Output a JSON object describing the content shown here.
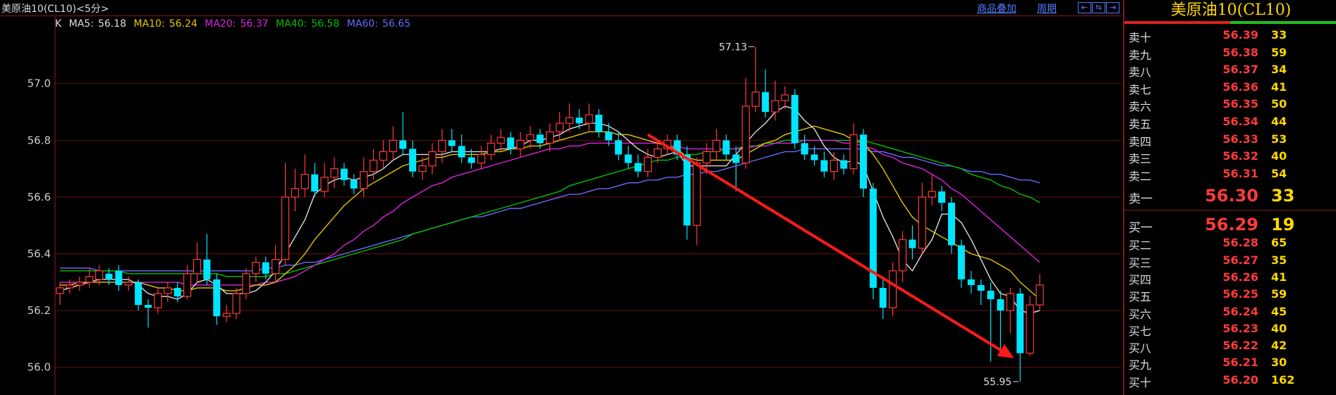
{
  "header": {
    "title": "美原油10(CL10)<5分>",
    "link_products": "商品叠加",
    "link_period": "周期",
    "nav_buttons": [
      "⇤",
      "⇆",
      "⇥"
    ]
  },
  "panel": {
    "title": "美原油10(CL10)",
    "asks": [
      {
        "label": "卖十",
        "price": "56.39",
        "vol": "33"
      },
      {
        "label": "卖九",
        "price": "56.38",
        "vol": "59"
      },
      {
        "label": "卖八",
        "price": "56.37",
        "vol": "34"
      },
      {
        "label": "卖七",
        "price": "56.36",
        "vol": "41"
      },
      {
        "label": "卖六",
        "price": "56.35",
        "vol": "50"
      },
      {
        "label": "卖五",
        "price": "56.34",
        "vol": "44"
      },
      {
        "label": "卖四",
        "price": "56.33",
        "vol": "53"
      },
      {
        "label": "卖三",
        "price": "56.32",
        "vol": "40"
      },
      {
        "label": "卖二",
        "price": "56.31",
        "vol": "54"
      },
      {
        "label": "卖一",
        "price": "56.30",
        "vol": "33"
      }
    ],
    "bids": [
      {
        "label": "买一",
        "price": "56.29",
        "vol": "19"
      },
      {
        "label": "买二",
        "price": "56.28",
        "vol": "65"
      },
      {
        "label": "买三",
        "price": "56.27",
        "vol": "35"
      },
      {
        "label": "买四",
        "price": "56.26",
        "vol": "41"
      },
      {
        "label": "买五",
        "price": "56.25",
        "vol": "59"
      },
      {
        "label": "买六",
        "price": "56.24",
        "vol": "45"
      },
      {
        "label": "买七",
        "price": "56.23",
        "vol": "40"
      },
      {
        "label": "买八",
        "price": "56.22",
        "vol": "42"
      },
      {
        "label": "买九",
        "price": "56.21",
        "vol": "30"
      },
      {
        "label": "买十",
        "price": "56.20",
        "vol": "162"
      }
    ]
  },
  "colors": {
    "up": "#ff3b3b",
    "down": "#00e5ff",
    "ma5": "#dddddd",
    "ma10": "#e6c700",
    "ma20": "#e020e0",
    "ma40": "#00c000",
    "ma60": "#6a6aff",
    "grid": "#6a0f0f",
    "arrow": "#ff1a1a"
  },
  "chart_data": {
    "type": "candlestick",
    "ylim": [
      55.91,
      57.22
    ],
    "yticks": [
      "57.0",
      "56.8",
      "56.6",
      "56.4",
      "56.2",
      "56.0"
    ],
    "legend": [
      {
        "name": "K",
        "value": ""
      },
      {
        "name": "MA5",
        "value": "56.18"
      },
      {
        "name": "MA10",
        "value": "56.24"
      },
      {
        "name": "MA20",
        "value": "56.37"
      },
      {
        "name": "MA40",
        "value": "56.58"
      },
      {
        "name": "MA60",
        "value": "56.65"
      }
    ],
    "annotations": {
      "high_label": "57.13",
      "low_label": "55.95"
    },
    "candles": [
      [
        56.26,
        56.28,
        56.22,
        56.3
      ],
      [
        56.28,
        56.29,
        56.26,
        56.31
      ],
      [
        56.29,
        56.3,
        56.27,
        56.32
      ],
      [
        56.3,
        56.32,
        56.28,
        56.35
      ],
      [
        56.31,
        56.34,
        56.29,
        56.36
      ],
      [
        56.33,
        56.31,
        56.29,
        56.35
      ],
      [
        56.34,
        56.29,
        56.27,
        56.36
      ],
      [
        56.29,
        56.3,
        56.27,
        56.32
      ],
      [
        56.3,
        56.22,
        56.2,
        56.31
      ],
      [
        56.22,
        56.21,
        56.14,
        56.24
      ],
      [
        56.21,
        56.26,
        56.19,
        56.28
      ],
      [
        56.26,
        56.28,
        56.23,
        56.3
      ],
      [
        56.28,
        56.25,
        56.23,
        56.3
      ],
      [
        56.25,
        56.33,
        56.24,
        56.36
      ],
      [
        56.33,
        56.38,
        56.3,
        56.44
      ],
      [
        56.38,
        56.31,
        56.29,
        56.47
      ],
      [
        56.31,
        56.18,
        56.15,
        56.33
      ],
      [
        56.18,
        56.19,
        56.16,
        56.22
      ],
      [
        56.19,
        56.26,
        56.17,
        56.28
      ],
      [
        56.26,
        56.33,
        56.24,
        56.35
      ],
      [
        56.33,
        56.37,
        56.3,
        56.39
      ],
      [
        56.37,
        56.33,
        56.31,
        56.39
      ],
      [
        56.33,
        56.38,
        56.3,
        56.43
      ],
      [
        56.38,
        56.6,
        56.36,
        56.72
      ],
      [
        56.6,
        56.63,
        56.55,
        56.7
      ],
      [
        56.63,
        56.68,
        56.6,
        56.75
      ],
      [
        56.68,
        56.62,
        56.6,
        56.72
      ],
      [
        56.62,
        56.67,
        56.6,
        56.72
      ],
      [
        56.67,
        56.7,
        56.63,
        56.74
      ],
      [
        56.7,
        56.66,
        56.64,
        56.72
      ],
      [
        56.66,
        56.63,
        56.61,
        56.68
      ],
      [
        56.63,
        56.69,
        56.6,
        56.74
      ],
      [
        56.69,
        56.73,
        56.66,
        56.77
      ],
      [
        56.73,
        56.76,
        56.7,
        56.8
      ],
      [
        56.76,
        56.8,
        56.73,
        56.85
      ],
      [
        56.8,
        56.77,
        56.75,
        56.9
      ],
      [
        56.77,
        56.69,
        56.67,
        56.8
      ],
      [
        56.69,
        56.71,
        56.66,
        56.74
      ],
      [
        56.71,
        56.76,
        56.68,
        56.79
      ],
      [
        56.76,
        56.8,
        56.72,
        56.84
      ],
      [
        56.8,
        56.78,
        56.76,
        56.84
      ],
      [
        56.78,
        56.74,
        56.72,
        56.82
      ],
      [
        56.74,
        56.72,
        56.7,
        56.77
      ],
      [
        56.72,
        56.75,
        56.7,
        56.78
      ],
      [
        56.75,
        56.79,
        56.73,
        56.82
      ],
      [
        56.79,
        56.81,
        56.76,
        56.84
      ],
      [
        56.81,
        56.77,
        56.75,
        56.83
      ],
      [
        56.77,
        56.8,
        56.74,
        56.83
      ],
      [
        56.8,
        56.82,
        56.77,
        56.85
      ],
      [
        56.82,
        56.79,
        56.77,
        56.84
      ],
      [
        56.79,
        56.83,
        56.76,
        56.86
      ],
      [
        56.83,
        56.86,
        56.8,
        56.9
      ],
      [
        56.86,
        56.88,
        56.83,
        56.93
      ],
      [
        56.88,
        56.86,
        56.84,
        56.91
      ],
      [
        56.86,
        56.89,
        56.83,
        56.93
      ],
      [
        56.89,
        56.83,
        56.81,
        56.91
      ],
      [
        56.83,
        56.8,
        56.78,
        56.86
      ],
      [
        56.8,
        56.75,
        56.73,
        56.83
      ],
      [
        56.75,
        56.72,
        56.7,
        56.78
      ],
      [
        56.72,
        56.69,
        56.67,
        56.75
      ],
      [
        56.69,
        56.74,
        56.67,
        56.77
      ],
      [
        56.74,
        56.77,
        56.72,
        56.8
      ],
      [
        56.77,
        56.8,
        56.75,
        56.82
      ],
      [
        56.8,
        56.75,
        56.73,
        56.82
      ],
      [
        56.75,
        56.5,
        56.45,
        56.78
      ],
      [
        56.5,
        56.72,
        56.43,
        56.74
      ],
      [
        56.72,
        56.76,
        56.68,
        56.79
      ],
      [
        56.76,
        56.8,
        56.73,
        56.84
      ],
      [
        56.8,
        56.75,
        56.73,
        56.82
      ],
      [
        56.75,
        56.72,
        56.62,
        56.78
      ],
      [
        56.72,
        56.92,
        56.7,
        57.02
      ],
      [
        56.92,
        56.97,
        56.9,
        57.13
      ],
      [
        56.97,
        56.9,
        56.88,
        57.05
      ],
      [
        56.9,
        56.94,
        56.87,
        57.01
      ],
      [
        56.94,
        56.96,
        56.91,
        56.99
      ],
      [
        56.96,
        56.79,
        56.77,
        56.98
      ],
      [
        56.79,
        56.75,
        56.73,
        56.82
      ],
      [
        56.75,
        56.73,
        56.71,
        56.78
      ],
      [
        56.73,
        56.69,
        56.67,
        56.76
      ],
      [
        56.69,
        56.73,
        56.66,
        56.76
      ],
      [
        56.73,
        56.7,
        56.68,
        56.75
      ],
      [
        56.7,
        56.82,
        56.68,
        56.86
      ],
      [
        56.82,
        56.63,
        56.6,
        56.84
      ],
      [
        56.63,
        56.28,
        56.24,
        56.65
      ],
      [
        56.28,
        56.21,
        56.17,
        56.32
      ],
      [
        56.21,
        56.34,
        56.18,
        56.37
      ],
      [
        56.34,
        56.45,
        56.3,
        56.48
      ],
      [
        56.45,
        56.42,
        56.38,
        56.5
      ],
      [
        56.42,
        56.6,
        56.4,
        56.65
      ],
      [
        56.6,
        56.62,
        56.57,
        56.68
      ],
      [
        56.62,
        56.58,
        56.55,
        56.64
      ],
      [
        56.58,
        56.43,
        56.4,
        56.6
      ],
      [
        56.43,
        56.31,
        56.28,
        56.45
      ],
      [
        56.31,
        56.29,
        56.26,
        56.34
      ],
      [
        56.29,
        56.27,
        56.22,
        56.31
      ],
      [
        56.27,
        56.24,
        56.02,
        56.3
      ],
      [
        56.24,
        56.2,
        56.05,
        56.27
      ],
      [
        56.2,
        56.26,
        56.12,
        56.28
      ],
      [
        56.26,
        56.05,
        55.95,
        56.28
      ],
      [
        56.05,
        56.22,
        56.04,
        56.25
      ],
      [
        56.22,
        56.29,
        56.2,
        56.33
      ]
    ],
    "ma5": [
      56.27,
      56.28,
      56.29,
      56.3,
      56.31,
      56.31,
      56.31,
      56.31,
      56.29,
      56.26,
      56.25,
      56.25,
      56.24,
      56.26,
      56.3,
      56.31,
      56.29,
      56.26,
      56.26,
      56.26,
      56.27,
      56.3,
      56.34,
      56.4,
      56.46,
      56.52,
      56.61,
      56.64,
      56.66,
      56.67,
      56.66,
      56.67,
      56.68,
      56.7,
      56.73,
      56.75,
      56.75,
      56.75,
      56.75,
      56.75,
      56.76,
      56.76,
      56.76,
      56.76,
      56.76,
      56.77,
      56.77,
      56.78,
      56.8,
      56.8,
      56.81,
      56.82,
      56.84,
      56.85,
      56.86,
      56.86,
      56.85,
      56.83,
      56.8,
      56.77,
      56.75,
      56.74,
      56.75,
      56.76,
      56.71,
      56.71,
      56.71,
      56.71,
      56.71,
      56.75,
      56.79,
      56.83,
      56.86,
      56.9,
      56.92,
      56.91,
      56.87,
      56.84,
      56.78,
      56.74,
      56.72,
      56.73,
      56.71,
      56.62,
      56.53,
      56.46,
      56.38,
      56.34,
      56.4,
      56.45,
      56.54,
      56.54,
      56.51,
      56.45,
      56.38,
      56.31,
      56.26,
      56.25,
      56.2,
      56.19,
      56.2
    ],
    "ma10": [
      56.29,
      56.29,
      56.3,
      56.3,
      56.3,
      56.3,
      56.3,
      56.3,
      56.3,
      56.29,
      56.28,
      56.28,
      56.27,
      56.27,
      56.28,
      56.28,
      56.28,
      56.27,
      56.27,
      56.28,
      56.29,
      56.29,
      56.3,
      56.33,
      56.36,
      56.4,
      56.45,
      56.49,
      56.53,
      56.57,
      56.6,
      56.63,
      56.65,
      56.67,
      56.69,
      56.71,
      56.72,
      56.73,
      56.74,
      56.74,
      56.75,
      56.75,
      56.75,
      56.75,
      56.76,
      56.76,
      56.77,
      56.77,
      56.78,
      56.78,
      56.79,
      56.8,
      56.81,
      56.82,
      56.83,
      56.83,
      56.83,
      56.82,
      56.82,
      56.81,
      56.8,
      56.79,
      56.78,
      56.77,
      56.74,
      56.73,
      56.73,
      56.73,
      56.73,
      56.73,
      56.75,
      56.77,
      56.79,
      56.8,
      56.82,
      56.83,
      56.84,
      56.85,
      56.84,
      56.83,
      56.82,
      56.8,
      56.79,
      56.75,
      56.7,
      56.64,
      56.58,
      56.53,
      56.5,
      56.48,
      56.46,
      56.44,
      56.42,
      56.4,
      56.39,
      56.38,
      56.36,
      56.34,
      56.3,
      56.27,
      56.24
    ],
    "ma20": [
      56.3,
      56.3,
      56.3,
      56.3,
      56.3,
      56.3,
      56.3,
      56.3,
      56.3,
      56.3,
      56.3,
      56.3,
      56.3,
      56.29,
      56.29,
      56.29,
      56.29,
      56.29,
      56.29,
      56.29,
      56.29,
      56.3,
      56.3,
      56.31,
      56.32,
      56.34,
      56.36,
      56.38,
      56.4,
      56.43,
      56.45,
      56.48,
      56.5,
      56.53,
      56.55,
      56.58,
      56.6,
      56.62,
      56.64,
      56.65,
      56.67,
      56.68,
      56.69,
      56.7,
      56.71,
      56.72,
      56.73,
      56.74,
      56.75,
      56.76,
      56.77,
      56.77,
      56.78,
      56.78,
      56.79,
      56.79,
      56.79,
      56.79,
      56.79,
      56.79,
      56.79,
      56.79,
      56.78,
      56.78,
      56.77,
      56.77,
      56.77,
      56.77,
      56.77,
      56.77,
      56.77,
      56.78,
      56.78,
      56.79,
      56.79,
      56.79,
      56.8,
      56.8,
      56.8,
      56.8,
      56.79,
      56.79,
      56.78,
      56.77,
      56.75,
      56.74,
      56.72,
      56.71,
      56.7,
      56.68,
      56.66,
      56.63,
      56.61,
      56.58,
      56.55,
      56.52,
      56.49,
      56.46,
      56.43,
      56.4,
      56.37
    ],
    "ma40": [
      56.34,
      56.34,
      56.34,
      56.34,
      56.34,
      56.34,
      56.34,
      56.33,
      56.33,
      56.33,
      56.33,
      56.33,
      56.33,
      56.33,
      56.33,
      56.33,
      56.33,
      56.32,
      56.32,
      56.32,
      56.32,
      56.32,
      56.33,
      56.33,
      56.34,
      56.35,
      56.36,
      56.37,
      56.38,
      56.39,
      56.4,
      56.41,
      56.42,
      56.43,
      56.44,
      56.45,
      56.47,
      56.48,
      56.49,
      56.5,
      56.51,
      56.52,
      56.53,
      56.54,
      56.55,
      56.56,
      56.57,
      56.58,
      56.59,
      56.6,
      56.61,
      56.62,
      56.64,
      56.65,
      56.66,
      56.67,
      56.68,
      56.69,
      56.7,
      56.71,
      56.72,
      56.73,
      56.73,
      56.74,
      56.75,
      56.75,
      56.76,
      56.76,
      56.77,
      56.77,
      56.78,
      56.78,
      56.79,
      56.79,
      56.8,
      56.8,
      56.8,
      56.8,
      56.8,
      56.8,
      56.8,
      56.8,
      56.8,
      56.79,
      56.78,
      56.77,
      56.76,
      56.75,
      56.74,
      56.73,
      56.72,
      56.71,
      56.7,
      56.68,
      56.67,
      56.66,
      56.64,
      56.63,
      56.61,
      56.6,
      56.58
    ],
    "ma60": [
      56.35,
      56.35,
      56.35,
      56.35,
      56.34,
      56.34,
      56.34,
      56.34,
      56.34,
      56.34,
      56.34,
      56.34,
      56.34,
      56.34,
      56.34,
      56.34,
      56.34,
      56.34,
      56.34,
      56.34,
      56.34,
      56.35,
      56.35,
      56.36,
      56.36,
      56.37,
      56.37,
      56.38,
      56.39,
      56.4,
      56.41,
      56.42,
      56.43,
      56.44,
      56.45,
      56.46,
      56.47,
      56.48,
      56.49,
      56.5,
      56.51,
      56.52,
      56.53,
      56.53,
      56.54,
      56.55,
      56.56,
      56.56,
      56.57,
      56.58,
      56.59,
      56.6,
      56.61,
      56.61,
      56.62,
      56.63,
      56.63,
      56.64,
      56.65,
      56.65,
      56.66,
      56.66,
      56.67,
      56.67,
      56.68,
      56.68,
      56.69,
      56.69,
      56.7,
      56.71,
      56.72,
      56.73,
      56.74,
      56.75,
      56.76,
      56.76,
      56.77,
      56.77,
      56.77,
      56.77,
      56.77,
      56.77,
      56.77,
      56.76,
      56.76,
      56.75,
      56.74,
      56.74,
      56.73,
      56.72,
      56.71,
      56.71,
      56.7,
      56.69,
      56.69,
      56.68,
      56.68,
      56.67,
      56.66,
      56.66,
      56.65
    ],
    "arrow": {
      "from": [
        60,
        56.82
      ],
      "to": [
        97,
        56.04
      ]
    }
  }
}
